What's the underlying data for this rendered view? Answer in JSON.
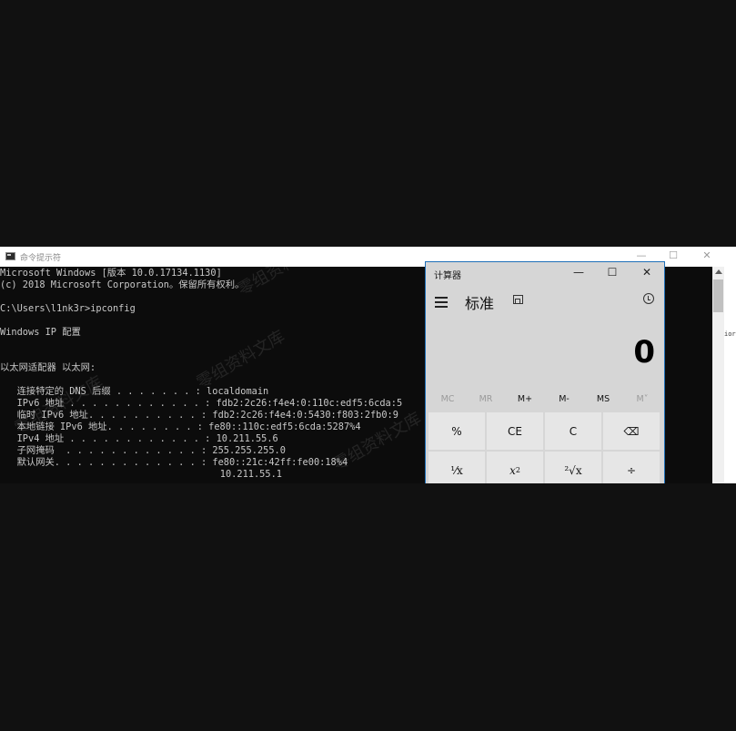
{
  "cmd": {
    "title": "命令提示符",
    "controls": {
      "minimize": "—",
      "maximize": "☐",
      "close": "✕"
    },
    "lines": [
      "Microsoft Windows [版本 10.0.17134.1130]",
      "(c) 2018 Microsoft Corporation。保留所有权利。",
      "",
      "C:\\Users\\l1nk3r>ipconfig",
      "",
      "Windows IP 配置",
      "",
      "",
      "以太网适配器 以太网:",
      "",
      "   连接特定的 DNS 后缀 . . . . . . . : localdomain",
      "   IPv6 地址 . . . . . . . . . . . . : fdb2:2c26:f4e4:0:110c:edf5:6cda:5",
      "   临时 IPv6 地址. . . . . . . . . . : fdb2:2c26:f4e4:0:5430:f803:2fb0:9",
      "   本地链接 IPv6 地址. . . . . . . . : fe80::110c:edf5:6cda:5287%4",
      "   IPv4 地址 . . . . . . . . . . . . : 10.211.55.6",
      "   子网掩码  . . . . . . . . . . . . : 255.255.255.0",
      "   默认网关. . . . . . . . . . . . . : fe80::21c:42ff:fe00:18%4",
      "                                       10.211.55.1"
    ]
  },
  "right_strip_text": "ior",
  "calculator": {
    "title": "计算器",
    "controls": {
      "minimize": "—",
      "maximize": "☐",
      "close": "✕"
    },
    "mode": "标准",
    "display": "0",
    "memory": [
      {
        "label": "MC",
        "enabled": false
      },
      {
        "label": "MR",
        "enabled": false
      },
      {
        "label": "M+",
        "enabled": true
      },
      {
        "label": "M-",
        "enabled": true
      },
      {
        "label": "MS",
        "enabled": true
      },
      {
        "label": "M˅",
        "enabled": false
      }
    ],
    "keys": {
      "percent": "%",
      "ce": "CE",
      "c": "C",
      "backspace": "⌫",
      "reciprocal": "¹⁄x",
      "square_base": "x",
      "square_exp": "2",
      "sqrt": "²√x",
      "divide": "÷"
    }
  },
  "watermark": "零组资料文库"
}
